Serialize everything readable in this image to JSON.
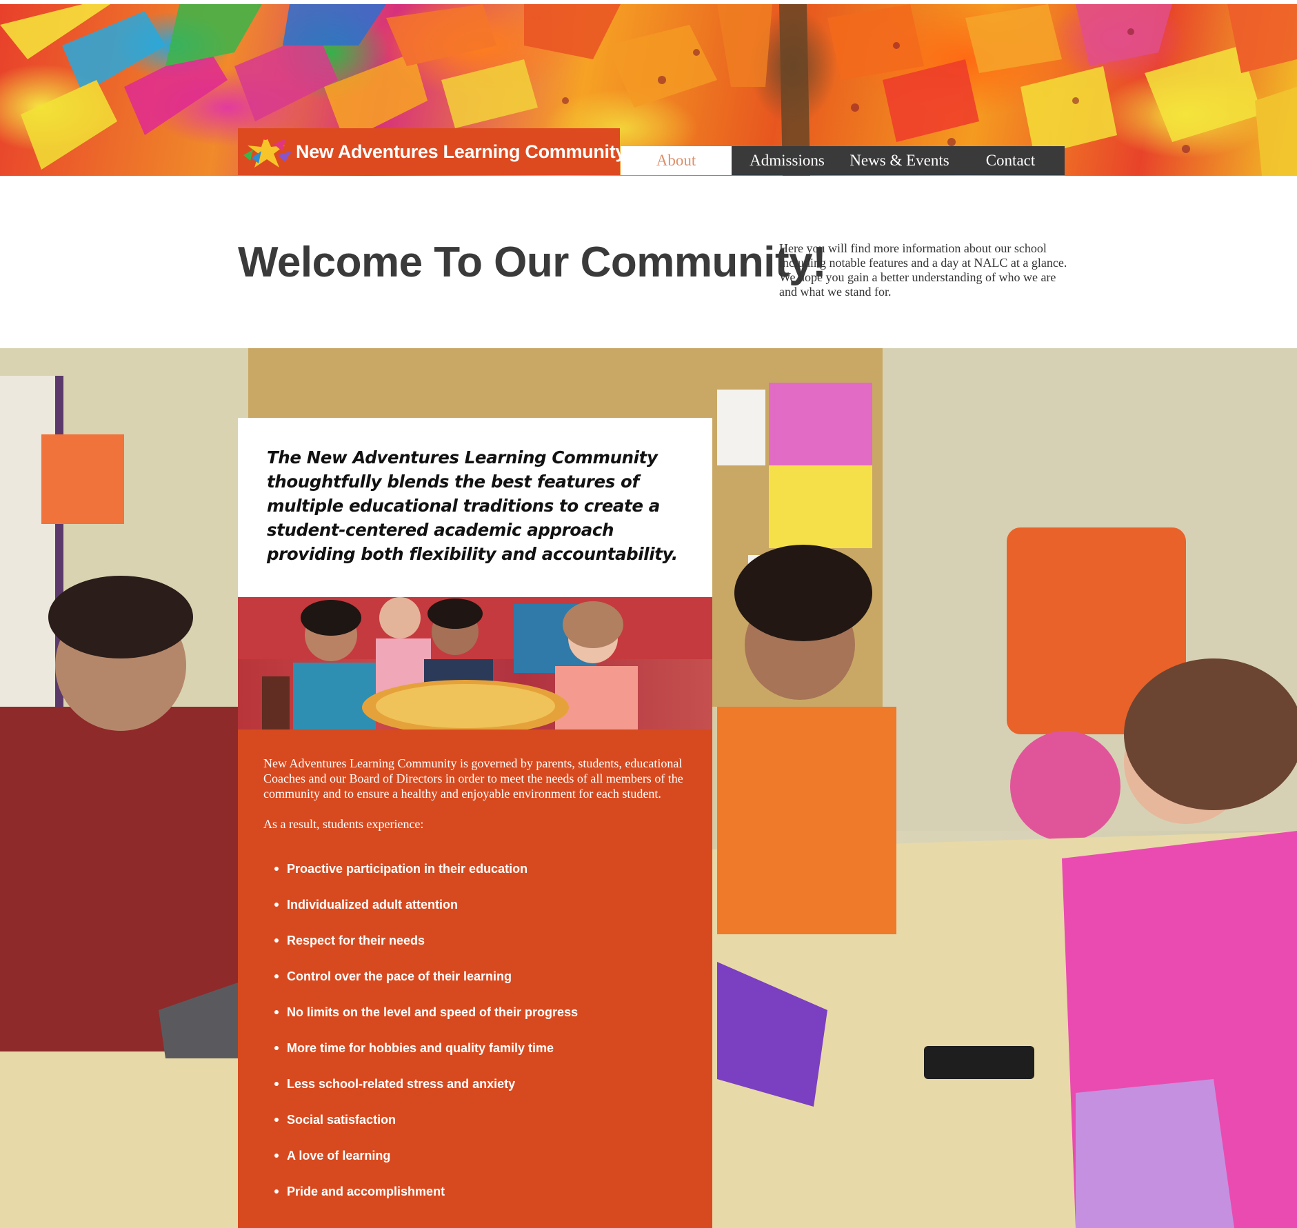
{
  "site": {
    "name": "New Adventures Learning Community"
  },
  "nav": {
    "items": [
      {
        "label": "About",
        "active": true
      },
      {
        "label": "Admissions",
        "active": false
      },
      {
        "label": "News & Events",
        "active": false
      },
      {
        "label": "Contact",
        "active": false
      }
    ]
  },
  "welcome": {
    "title": "Welcome To Our Community!",
    "text": "Here you will find more information about our school including notable features and a day at NALC at a glance. We hope you gain a better understanding of who we are and what we stand for."
  },
  "intro": {
    "text": "The New Adventures Learning Community thoughtfully blends the best features of multiple educational traditions to create a student-centered academic approach providing both flexibility and accountability."
  },
  "info": {
    "paragraph1": "New Adventures Learning Community is governed by parents, students, educational Coaches and our Board of Directors in order to meet the needs of all members of the community and to ensure a healthy and enjoyable environment for each student.",
    "paragraph2": "As a result, students experience:",
    "experiences": [
      "Proactive participation in their education",
      "Individualized adult attention",
      "Respect for their needs",
      "Control over the pace of their learning",
      "No limits on the level and speed of their progress",
      "More time for hobbies and quality family time",
      "Less school-related stress and anxiety",
      "Social satisfaction",
      "A love of learning",
      "Pride and accomplishment"
    ]
  },
  "colors": {
    "brand_orange": "#dd4a1f",
    "nav_dark": "#3a3a3a",
    "nav_active_text": "#dd8f6a",
    "heading_text": "#3a3a3a",
    "info_card": "#d74a1f"
  },
  "images": {
    "banner": "children-painting-banner",
    "logo": "star-figures-logo",
    "background": "classroom-students-photo",
    "strip": "students-pizza-photo"
  }
}
